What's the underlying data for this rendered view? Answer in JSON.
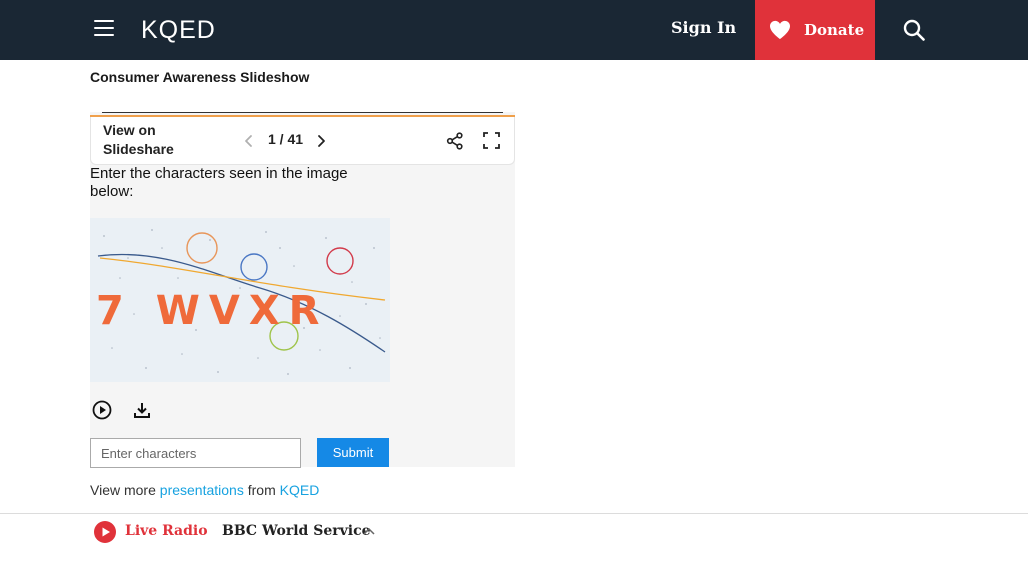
{
  "header": {
    "logo_text": "KQED",
    "signin_label": "Sign In",
    "donate_label": "Donate",
    "icons": [
      "menu-icon",
      "heart-icon",
      "search-icon"
    ],
    "colors": {
      "background": "#1a2734",
      "donate": "#e0323a"
    }
  },
  "page": {
    "title": "Consumer Awareness Slideshow"
  },
  "embed": {
    "view_on_label": "View on Slideshare",
    "page_count": "1 / 41",
    "captcha": {
      "prompt": "Enter the characters seen in the image below:",
      "characters": "7 WVXR",
      "input_placeholder": "Enter characters",
      "submit_label": "Submit"
    },
    "icons": [
      "chevron-left-icon",
      "chevron-right-icon",
      "share-icon",
      "fullscreen-icon",
      "play-icon",
      "download-icon"
    ]
  },
  "view_more": {
    "prefix": "View more",
    "link1": "presentations",
    "middle": "from",
    "link2": "KQED"
  },
  "player": {
    "live_label": "Live Radio",
    "station": "BBC World Service",
    "accent": "#e0323a"
  }
}
